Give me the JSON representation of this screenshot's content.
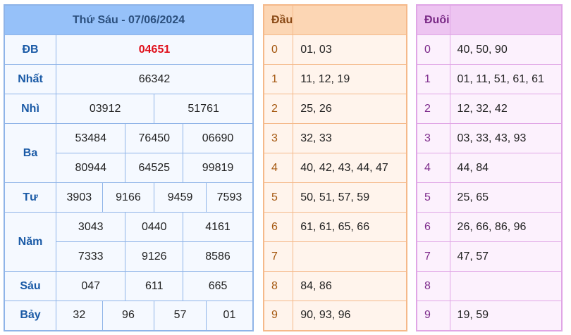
{
  "results": {
    "title": "Thứ Sáu - 07/06/2024",
    "prizes": {
      "db": {
        "label": "ĐB",
        "values": [
          "04651"
        ]
      },
      "nhat": {
        "label": "Nhất",
        "values": [
          "66342"
        ]
      },
      "nhi": {
        "label": "Nhì",
        "values": [
          "03912",
          "51761"
        ]
      },
      "ba": {
        "label": "Ba",
        "values": [
          "53484",
          "76450",
          "06690",
          "80944",
          "64525",
          "99819"
        ]
      },
      "tu": {
        "label": "Tư",
        "values": [
          "3903",
          "9166",
          "9459",
          "7593"
        ]
      },
      "nam": {
        "label": "Năm",
        "values": [
          "3043",
          "0440",
          "4161",
          "7333",
          "9126",
          "8586"
        ]
      },
      "sau": {
        "label": "Sáu",
        "values": [
          "047",
          "611",
          "665"
        ]
      },
      "bay": {
        "label": "Bảy",
        "values": [
          "32",
          "96",
          "57",
          "01"
        ]
      }
    },
    "colors": {
      "special": "#e0101b",
      "label": "#1a5aa6",
      "header": "#96c1f9"
    }
  },
  "dau": {
    "title": "Đầu",
    "rows": [
      {
        "digit": "0",
        "values": "01, 03"
      },
      {
        "digit": "1",
        "values": "11, 12, 19"
      },
      {
        "digit": "2",
        "values": "25, 26"
      },
      {
        "digit": "3",
        "values": "32, 33"
      },
      {
        "digit": "4",
        "values": "40, 42, 43, 44, 47"
      },
      {
        "digit": "5",
        "values": "50, 51, 57, 59"
      },
      {
        "digit": "6",
        "values": "61, 61, 65, 66"
      },
      {
        "digit": "7",
        "values": ""
      },
      {
        "digit": "8",
        "values": "84, 86"
      },
      {
        "digit": "9",
        "values": "90, 93, 96"
      }
    ]
  },
  "duoi": {
    "title": "Đuôi",
    "rows": [
      {
        "digit": "0",
        "values": "40, 50, 90"
      },
      {
        "digit": "1",
        "values": "01, 11, 51, 61, 61"
      },
      {
        "digit": "2",
        "values": "12, 32, 42"
      },
      {
        "digit": "3",
        "values": "03, 33, 43, 93"
      },
      {
        "digit": "4",
        "values": "44, 84"
      },
      {
        "digit": "5",
        "values": "25, 65"
      },
      {
        "digit": "6",
        "values": "26, 66, 86, 96"
      },
      {
        "digit": "7",
        "values": "47, 57"
      },
      {
        "digit": "8",
        "values": ""
      },
      {
        "digit": "9",
        "values": "19, 59"
      }
    ]
  }
}
